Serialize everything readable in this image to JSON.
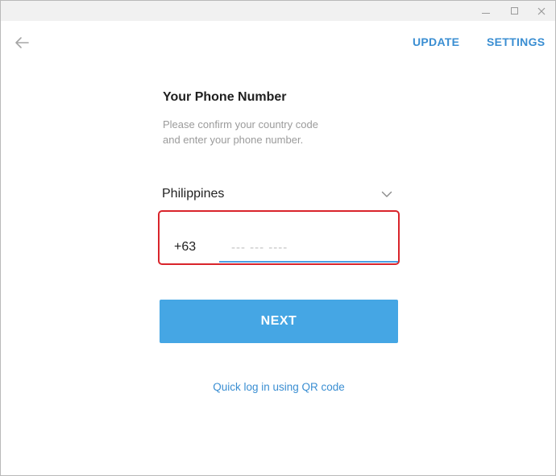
{
  "window": {
    "controls": [
      "minimize-icon",
      "maximize-icon",
      "close-icon"
    ]
  },
  "header": {
    "back_icon": "arrow-left-icon",
    "update_label": "UPDATE",
    "settings_label": "SETTINGS"
  },
  "login": {
    "title": "Your Phone Number",
    "description_lines": [
      "Please confirm your country code",
      "and enter your phone number."
    ],
    "country": "Philippines",
    "country_icon": "chevron-down-icon",
    "country_code": "+63",
    "phone_value": "",
    "phone_placeholder": "--- --- ----",
    "next_label": "NEXT",
    "qr_link": "Quick log in using QR code"
  },
  "colors": {
    "accent": "#45a6e4",
    "link": "#3a8ed2",
    "highlight": "#d9242b",
    "muted_text": "#9b9b9b"
  }
}
